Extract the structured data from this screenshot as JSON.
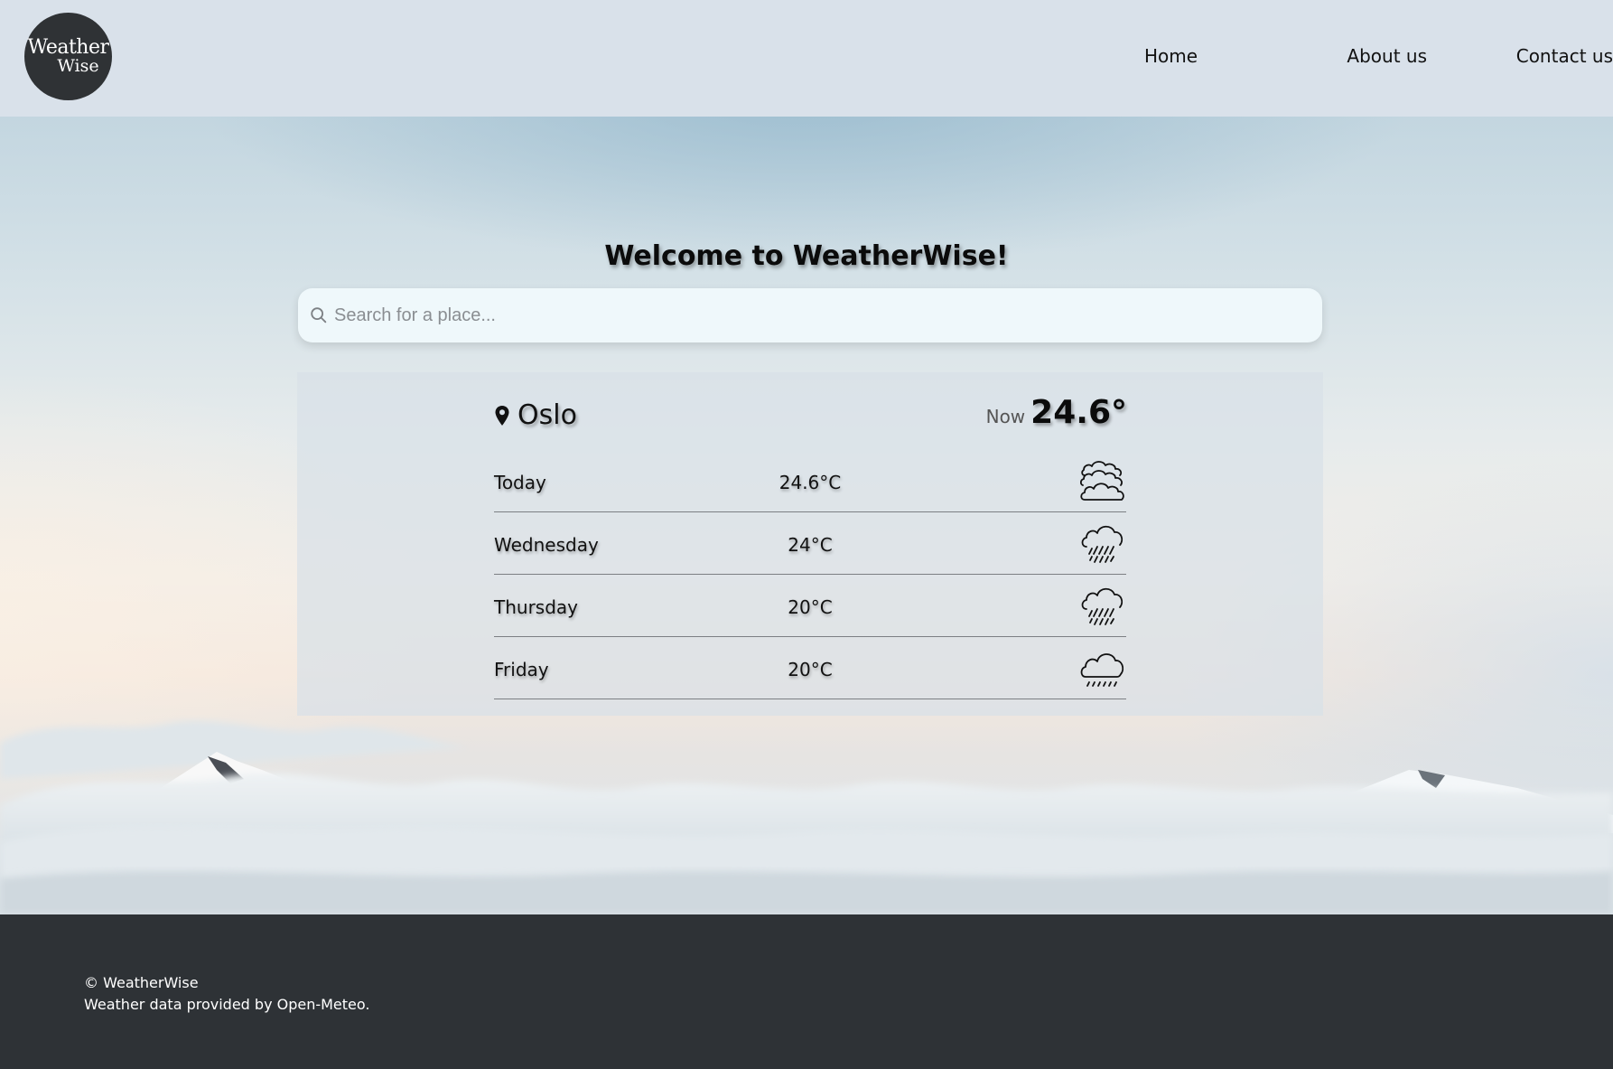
{
  "logo": {
    "line1": "Weather",
    "line2": "Wise"
  },
  "nav": {
    "items": [
      {
        "label": "Home"
      },
      {
        "label": "About us"
      },
      {
        "label": "Contact us"
      }
    ]
  },
  "hero": {
    "title": "Welcome to WeatherWise!"
  },
  "search": {
    "placeholder": "Search for a place...",
    "value": ""
  },
  "forecast": {
    "city": "Oslo",
    "now_label": "Now",
    "now_temp": "24.6°",
    "days": [
      {
        "day": "Today",
        "temp": "24.6°C",
        "icon": "overcast-clouds-icon"
      },
      {
        "day": "Wednesday",
        "temp": "24°C",
        "icon": "heavy-rain-icon"
      },
      {
        "day": "Thursday",
        "temp": "20°C",
        "icon": "heavy-rain-icon"
      },
      {
        "day": "Friday",
        "temp": "20°C",
        "icon": "drizzle-icon"
      }
    ]
  },
  "footer": {
    "copyright": "© WeatherWise",
    "credit": "Weather data provided by Open-Meteo."
  },
  "colors": {
    "header_bg": "#d9e1ea",
    "logo_bg": "#2f3235",
    "search_bg": "#eff8fb",
    "footer_bg": "#2e3236"
  }
}
